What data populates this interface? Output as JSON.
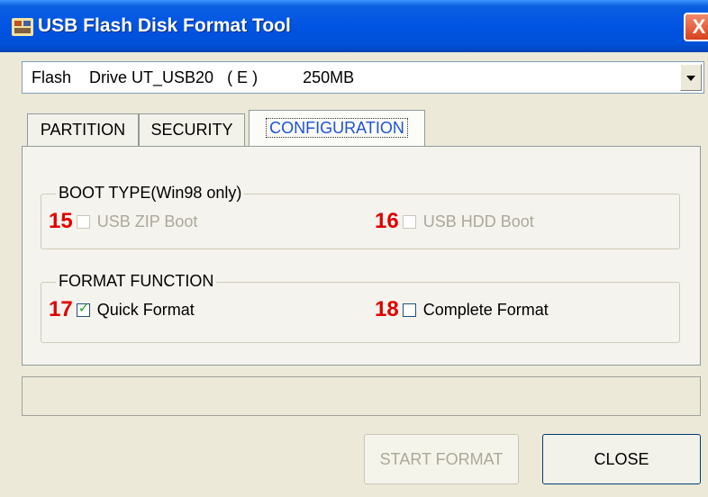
{
  "window": {
    "title": "USB Flash Disk Format Tool",
    "close_glyph": "X"
  },
  "drive_select": {
    "value": "Flash    Drive UT_USB20   ( E )          250MB"
  },
  "tabs": [
    {
      "label": "PARTITION",
      "active": false
    },
    {
      "label": "SECURITY",
      "active": false
    },
    {
      "label": "CONFIGURATION",
      "active": true
    }
  ],
  "boot_type": {
    "label": "BOOT TYPE(Win98 only)",
    "options": [
      {
        "num": "15",
        "label": "USB ZIP Boot",
        "checked": false,
        "enabled": false
      },
      {
        "num": "16",
        "label": "USB HDD Boot",
        "checked": false,
        "enabled": false
      }
    ]
  },
  "format_function": {
    "label": "FORMAT FUNCTION",
    "options": [
      {
        "num": "17",
        "label": "Quick Format",
        "checked": true,
        "enabled": true
      },
      {
        "num": "18",
        "label": "Complete Format",
        "checked": false,
        "enabled": true
      }
    ]
  },
  "status_text": "",
  "buttons": {
    "start_format": "START FORMAT",
    "close": "CLOSE"
  },
  "colors": {
    "titlebar": "#0054e3",
    "annotation_numbers": "#e00000",
    "active_tab_text": "#1e52d6",
    "window_bg": "#ece9d8"
  },
  "icons": {
    "title": "usb-tool-icon",
    "close": "close-icon",
    "dropdown": "chevron-down-icon",
    "checkmark": "checkmark-icon"
  }
}
